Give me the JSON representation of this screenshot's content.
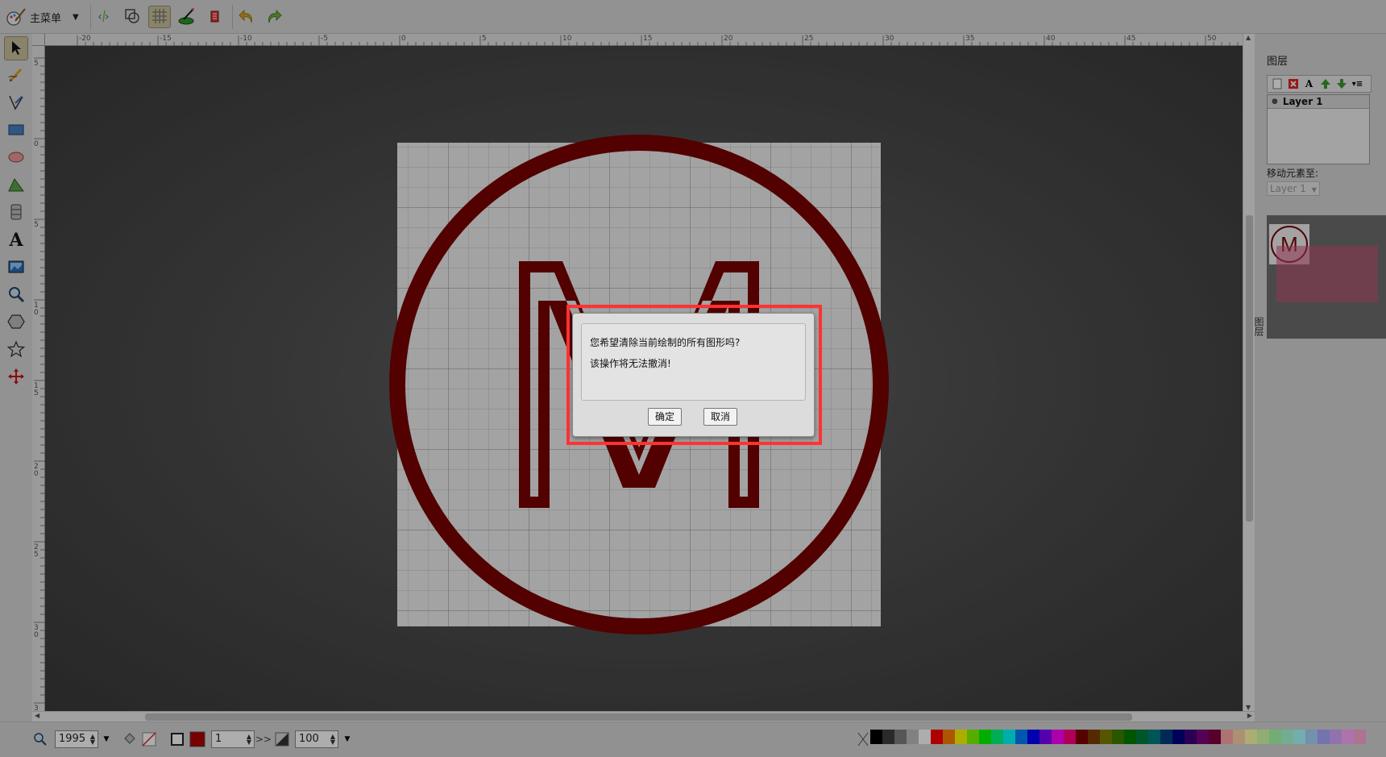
{
  "toolbar": {
    "main_menu_label": "主菜单",
    "buttons": [
      "source-editor",
      "wireframe-mode",
      "grid-toggle",
      "document-properties",
      "clear-drawing",
      "undo",
      "redo"
    ]
  },
  "left_tools": [
    "select",
    "pencil",
    "pen",
    "rectangle",
    "ellipse",
    "path",
    "shape-library",
    "text",
    "image",
    "zoom",
    "polygon",
    "star",
    "transform"
  ],
  "ruler": {
    "top_labels": [
      "-20",
      "-15",
      "-10",
      "-5",
      "0",
      "5",
      "10",
      "15",
      "20",
      "25",
      "30",
      "35",
      "40",
      "45",
      "50"
    ],
    "left_labels": [
      "5",
      "0",
      "5",
      "1 0",
      "1 5",
      "2 0",
      "2 5",
      "3 0",
      "3"
    ]
  },
  "canvas": {
    "stroke_color": "#7a0000",
    "glyph": "M"
  },
  "layers_panel": {
    "title": "图层",
    "tab_label": "图层",
    "layer_name": "Layer 1",
    "move_to_label": "移动元素至:",
    "move_to_value": "Layer 1"
  },
  "bottom": {
    "zoom_value": "1995",
    "stroke_width": "1",
    "opacity": "100",
    "fill_color": "#b00000",
    "arrows": ">>"
  },
  "palette": [
    "#000000",
    "#3f3f3f",
    "#7f7f7f",
    "#bfbfbf",
    "#ffffff",
    "#ff0000",
    "#ff7f00",
    "#ffff00",
    "#7fff00",
    "#00ff00",
    "#00ff7f",
    "#00ffff",
    "#007fff",
    "#0000ff",
    "#7f00ff",
    "#ff00ff",
    "#ff007f",
    "#7f0000",
    "#7f3f00",
    "#7f7f00",
    "#3f7f00",
    "#007f00",
    "#007f3f",
    "#007f7f",
    "#003f7f",
    "#00007f",
    "#3f007f",
    "#7f007f",
    "#7f003f",
    "#ffaaaa",
    "#ffd4aa",
    "#ffffaa",
    "#d4ffaa",
    "#aaffaa",
    "#aaffd4",
    "#aaffff",
    "#aad4ff",
    "#aaaaff",
    "#d4aaff",
    "#ffaaff",
    "#ffaad4"
  ],
  "dialog": {
    "message": "您希望清除当前绘制的所有图形吗?",
    "warning": "该操作将无法撤消!",
    "ok_label": "确定",
    "cancel_label": "取消"
  }
}
